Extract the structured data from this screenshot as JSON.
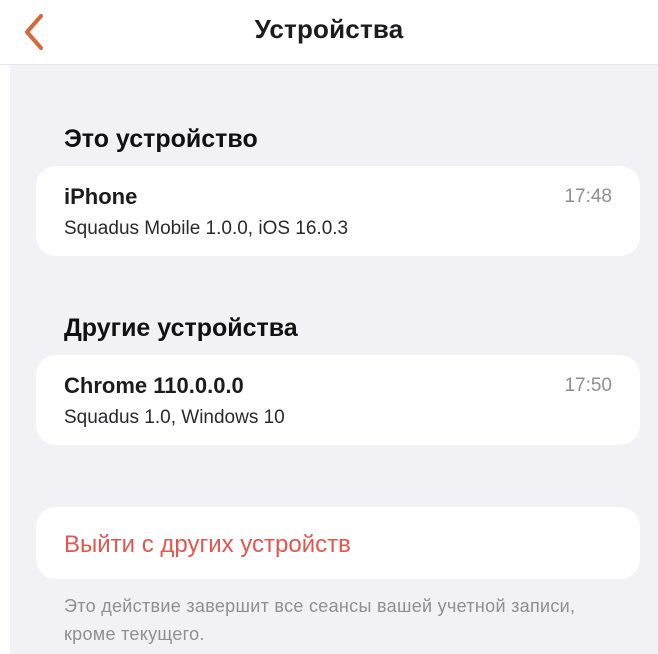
{
  "nav": {
    "title": "Устройства",
    "back_icon": "chevron-left-icon",
    "accent_color": "#d46a3a"
  },
  "this_device": {
    "header": "Это устройство",
    "name": "iPhone",
    "details": "Squadus Mobile 1.0.0, iOS 16.0.3",
    "time": "17:48"
  },
  "other_devices": {
    "header": "Другие устройства",
    "items": [
      {
        "name": "Chrome 110.0.0.0",
        "details": "Squadus 1.0, Windows 10",
        "time": "17:50"
      }
    ]
  },
  "logout": {
    "label": "Выйти с других устройств",
    "color": "#e0574f"
  },
  "footnote": "Это действие завершит все сеансы вашей учетной записи, кроме текущего."
}
